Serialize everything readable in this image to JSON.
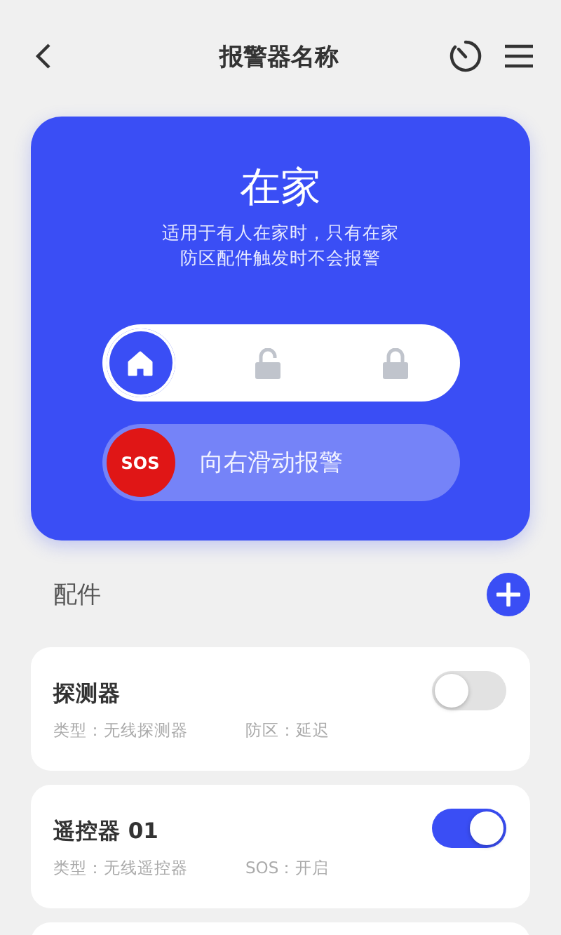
{
  "header": {
    "title": "报警器名称"
  },
  "mode_card": {
    "title": "在家",
    "description": [
      "适用于有人在家时，只有在家",
      "防区配件触发时不会报警"
    ],
    "mode_slider": [
      {
        "kind": "home",
        "selected": true
      },
      {
        "kind": "unlocked",
        "selected": false
      },
      {
        "kind": "locked",
        "selected": false
      }
    ],
    "sos_slider": {
      "knob": "SOS",
      "label": "向右滑动报警",
      "level": 0
    }
  },
  "accessories_section": {
    "title": "配件"
  },
  "accessories": [
    {
      "kind": "accessory",
      "name": "探测器",
      "type": "类型：无线探测器",
      "detail": "防区：延迟",
      "on": false
    },
    {
      "kind": "accessory",
      "name": "遥控器 01",
      "type": "类型：无线遥控器",
      "detail": "SOS：开启",
      "on": true
    },
    {
      "kind": "partial"
    }
  ]
}
